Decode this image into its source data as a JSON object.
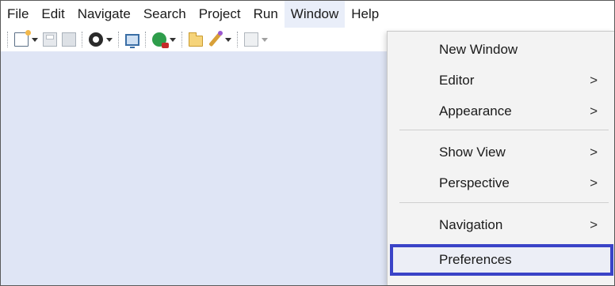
{
  "menubar": {
    "items": [
      "File",
      "Edit",
      "Navigate",
      "Search",
      "Project",
      "Run",
      "Window",
      "Help"
    ],
    "active": "Window"
  },
  "toolbar": {
    "icons": [
      "new-wizard-icon",
      "save-icon",
      "save-all-icon",
      "debug-icon",
      "console-icon",
      "run-icon",
      "open-folder-icon",
      "external-tools-icon",
      "import-icon"
    ]
  },
  "window_menu": {
    "new_window": "New Window",
    "editor": "Editor",
    "appearance": "Appearance",
    "show_view": "Show View",
    "perspective": "Perspective",
    "navigation": "Navigation",
    "preferences": "Preferences",
    "submenu_chevron": ">"
  },
  "colors": {
    "workspace_bg": "#dfe5f5",
    "menu_bg": "#f3f3f3",
    "highlight_border": "#3a43c7"
  }
}
